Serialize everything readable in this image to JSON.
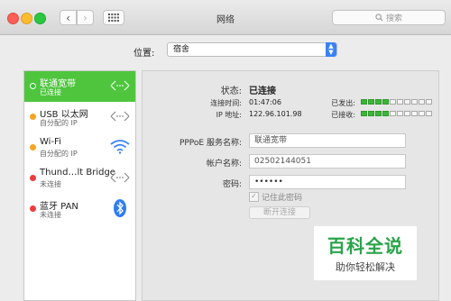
{
  "window": {
    "title": "网络",
    "search_placeholder": "搜索"
  },
  "location": {
    "label": "位置:",
    "value": "宿舍"
  },
  "services": [
    {
      "name": "联通宽带",
      "status": "已连接",
      "dot": "green",
      "icon": "ethernet-arrows-icon",
      "selected": true
    },
    {
      "name": "USB 以太网",
      "status": "自分配的 IP",
      "dot": "orange",
      "icon": "ethernet-arrows-icon",
      "selected": false
    },
    {
      "name": "Wi-Fi",
      "status": "自分配的 IP",
      "dot": "orange",
      "icon": "wifi-icon",
      "selected": false
    },
    {
      "name": "Thund…lt Bridge",
      "status": "未连接",
      "dot": "red",
      "icon": "ethernet-arrows-icon",
      "selected": false
    },
    {
      "name": "蓝牙 PAN",
      "status": "未连接",
      "dot": "red",
      "icon": "bluetooth-icon",
      "selected": false
    }
  ],
  "detail": {
    "status_label": "状态:",
    "status_value": "已连接",
    "time_label": "连接时间:",
    "time_value": "01:47:06",
    "ip_label": "IP 地址:",
    "ip_value": "122.96.101.98",
    "sent_label": "已发出:",
    "recv_label": "已接收:",
    "sent_level": 0.4,
    "recv_level": 0.4,
    "service_label": "PPPoE 服务名称:",
    "service_value": "联通宽带",
    "account_label": "帐户名称:",
    "account_value": "02502144051",
    "password_label": "密码:",
    "password_value": "••••••",
    "remember_label": "记住此密码",
    "disconnect_label": "断开连接"
  },
  "watermark": {
    "main": "百科全说",
    "sub": "助你轻松解决"
  },
  "colors": {
    "selected": "#4fc53e",
    "status_green": "#37c53b",
    "status_orange": "#f5a623",
    "status_red": "#ec3d3d",
    "accent": "#3a82f6"
  }
}
